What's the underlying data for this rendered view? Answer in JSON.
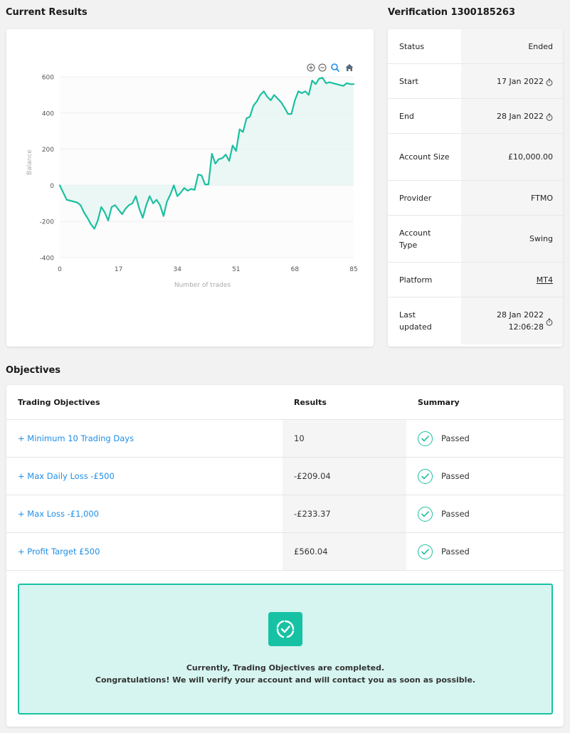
{
  "headings": {
    "current_results": "Current Results",
    "verification": "Verification 1300185263",
    "objectives": "Objectives"
  },
  "chart_data": {
    "type": "area",
    "xlabel": "Number of trades",
    "ylabel": "Balance",
    "xlim": [
      0,
      85
    ],
    "ylim": [
      -400,
      600
    ],
    "xticks": [
      "0",
      "17",
      "34",
      "51",
      "68",
      "85"
    ],
    "yticks": [
      "600",
      "400",
      "200",
      "0",
      "-200",
      "-400"
    ],
    "grid": true,
    "x": [
      0,
      2,
      5,
      6,
      7,
      8,
      9,
      10,
      11,
      12,
      13,
      14,
      15,
      16,
      17,
      18,
      19,
      20,
      21,
      22,
      23,
      24,
      25,
      26,
      27,
      28,
      29,
      30,
      31,
      32,
      33,
      34,
      35,
      36,
      37,
      38,
      39,
      40,
      41,
      42,
      43,
      44,
      45,
      46,
      47,
      48,
      49,
      50,
      51,
      52,
      53,
      54,
      55,
      56,
      57,
      58,
      59,
      60,
      61,
      62,
      63,
      64,
      65,
      66,
      67,
      68,
      69,
      70,
      71,
      72,
      73,
      74,
      75,
      76,
      77,
      78,
      79,
      80,
      81,
      82,
      83,
      84,
      85
    ],
    "y": [
      0,
      -80,
      -95,
      -110,
      -150,
      -180,
      -215,
      -240,
      -195,
      -120,
      -150,
      -195,
      -120,
      -110,
      -135,
      -160,
      -130,
      -110,
      -100,
      -60,
      -130,
      -180,
      -110,
      -60,
      -100,
      -80,
      -110,
      -170,
      -90,
      -50,
      0,
      -60,
      -40,
      -15,
      -30,
      -20,
      -25,
      60,
      55,
      5,
      5,
      175,
      120,
      145,
      150,
      170,
      135,
      220,
      190,
      310,
      295,
      370,
      380,
      440,
      465,
      500,
      520,
      490,
      470,
      500,
      480,
      460,
      430,
      395,
      395,
      470,
      520,
      510,
      520,
      500,
      580,
      560,
      590,
      595,
      565,
      570,
      565,
      560,
      555,
      550,
      565,
      560,
      560
    ],
    "line_color": "#1bbf9f",
    "fill_color": "#e8f6f3",
    "toolbar": [
      "zoom-in-icon",
      "zoom-out-icon",
      "zoom-select-icon",
      "home-icon"
    ]
  },
  "info": [
    {
      "label": "Status",
      "value": "Ended",
      "icon": ""
    },
    {
      "label": "Start",
      "value": "17 Jan 2022",
      "icon": "stopwatch-icon"
    },
    {
      "label": "End",
      "value": "28 Jan 2022",
      "icon": "stopwatch-icon"
    },
    {
      "label": "Account Size",
      "value": "£10,000.00",
      "icon": ""
    },
    {
      "label": "Provider",
      "value": "FTMO",
      "icon": ""
    },
    {
      "label": "Account Type",
      "value": "Swing",
      "icon": ""
    },
    {
      "label": "Platform",
      "value": "MT4",
      "icon": "",
      "link": true
    },
    {
      "label": "Last updated",
      "value": "28 Jan 2022 12:06:28",
      "icon": "stopwatch-icon"
    }
  ],
  "objectives_table": {
    "headers": [
      "Trading Objectives",
      "Results",
      "Summary"
    ],
    "rows": [
      {
        "objective": "+ Minimum 10 Trading Days",
        "result": "10",
        "summary": "Passed"
      },
      {
        "objective": "+ Max Daily Loss -£500",
        "result": "-£209.04",
        "summary": "Passed"
      },
      {
        "objective": "+ Max Loss -£1,000",
        "result": "-£233.37",
        "summary": "Passed"
      },
      {
        "objective": "+ Profit Target £500",
        "result": "£560.04",
        "summary": "Passed"
      }
    ]
  },
  "completion": {
    "line1": "Currently, Trading Objectives are completed.",
    "line2": "Congratulations! We will verify your account and will contact you as soon as possible.",
    "icon": "completed-badge-icon",
    "accent": "#17c2a4"
  }
}
